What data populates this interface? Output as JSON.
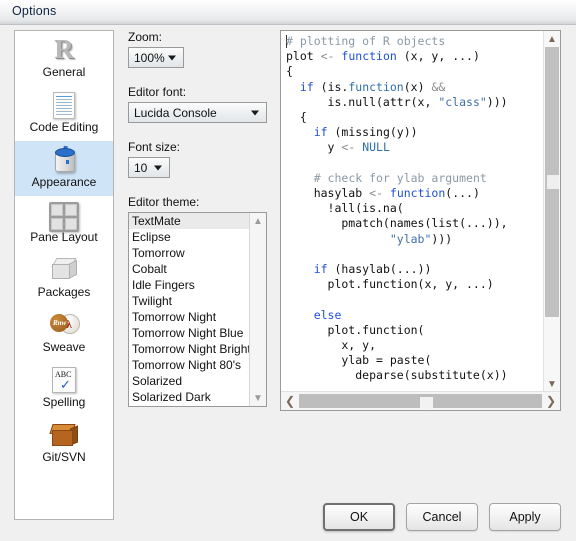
{
  "window": {
    "title": "Options"
  },
  "sidebar": {
    "items": [
      {
        "label": "General",
        "icon": "r-logo-icon",
        "selected": false
      },
      {
        "label": "Code Editing",
        "icon": "document-icon",
        "selected": false
      },
      {
        "label": "Appearance",
        "icon": "paint-can-icon",
        "selected": true
      },
      {
        "label": "Pane Layout",
        "icon": "panes-grid-icon",
        "selected": false
      },
      {
        "label": "Packages",
        "icon": "box-icon",
        "selected": false
      },
      {
        "label": "Sweave",
        "icon": "sweave-pdf-icon",
        "selected": false
      },
      {
        "label": "Spelling",
        "icon": "abc-check-icon",
        "selected": false
      },
      {
        "label": "Git/SVN",
        "icon": "crate-icon",
        "selected": false
      }
    ]
  },
  "settings": {
    "zoom": {
      "label": "Zoom:",
      "value": "100%"
    },
    "editor_font": {
      "label": "Editor font:",
      "value": "Lucida Console"
    },
    "font_size": {
      "label": "Font size:",
      "value": "10"
    },
    "editor_theme": {
      "label": "Editor theme:",
      "selected": "TextMate",
      "options": [
        "TextMate",
        "Eclipse",
        "Tomorrow",
        "Cobalt",
        "Idle Fingers",
        "Twilight",
        "Tomorrow Night",
        "Tomorrow Night Blue",
        "Tomorrow Night Bright",
        "Tomorrow Night 80's",
        "Solarized",
        "Solarized Dark"
      ]
    }
  },
  "preview": {
    "lines": [
      [
        {
          "t": "# plotting of R objects",
          "c": "cm"
        }
      ],
      [
        {
          "t": "plot ",
          "c": "pl"
        },
        {
          "t": "<-",
          "c": "op"
        },
        {
          "t": " ",
          "c": "pl"
        },
        {
          "t": "function",
          "c": "kw"
        },
        {
          "t": " (x, y, ...)",
          "c": "pl"
        }
      ],
      [
        {
          "t": "{",
          "c": "pl"
        }
      ],
      [
        {
          "t": "  ",
          "c": "pl"
        },
        {
          "t": "if",
          "c": "kw"
        },
        {
          "t": " (is.",
          "c": "pl"
        },
        {
          "t": "function",
          "c": "fn"
        },
        {
          "t": "(x) ",
          "c": "pl"
        },
        {
          "t": "&&",
          "c": "op"
        }
      ],
      [
        {
          "t": "      is.null(attr(x, ",
          "c": "pl"
        },
        {
          "t": "\"class\"",
          "c": "st"
        },
        {
          "t": ")))",
          "c": "pl"
        }
      ],
      [
        {
          "t": "  {",
          "c": "pl"
        }
      ],
      [
        {
          "t": "    ",
          "c": "pl"
        },
        {
          "t": "if",
          "c": "kw"
        },
        {
          "t": " (missing(y))",
          "c": "pl"
        }
      ],
      [
        {
          "t": "      y ",
          "c": "pl"
        },
        {
          "t": "<-",
          "c": "op"
        },
        {
          "t": " ",
          "c": "pl"
        },
        {
          "t": "NULL",
          "c": "fn"
        }
      ],
      [
        {
          "t": "",
          "c": "pl"
        }
      ],
      [
        {
          "t": "    ",
          "c": "pl"
        },
        {
          "t": "# check for ylab argument",
          "c": "cm"
        }
      ],
      [
        {
          "t": "    hasylab ",
          "c": "pl"
        },
        {
          "t": "<-",
          "c": "op"
        },
        {
          "t": " ",
          "c": "pl"
        },
        {
          "t": "function",
          "c": "kw"
        },
        {
          "t": "(...)",
          "c": "pl"
        }
      ],
      [
        {
          "t": "      !all(is.na(",
          "c": "pl"
        }
      ],
      [
        {
          "t": "        pmatch(names(list(...)),",
          "c": "pl"
        }
      ],
      [
        {
          "t": "               ",
          "c": "pl"
        },
        {
          "t": "\"ylab\"",
          "c": "st"
        },
        {
          "t": ")))",
          "c": "pl"
        }
      ],
      [
        {
          "t": "",
          "c": "pl"
        }
      ],
      [
        {
          "t": "    ",
          "c": "pl"
        },
        {
          "t": "if",
          "c": "kw"
        },
        {
          "t": " (hasylab(...))",
          "c": "pl"
        }
      ],
      [
        {
          "t": "      plot.function(x, y, ...)",
          "c": "pl"
        }
      ],
      [
        {
          "t": "",
          "c": "pl"
        }
      ],
      [
        {
          "t": "    ",
          "c": "pl"
        },
        {
          "t": "else",
          "c": "kw"
        }
      ],
      [
        {
          "t": "      plot.function(",
          "c": "pl"
        }
      ],
      [
        {
          "t": "        x, y,",
          "c": "pl"
        }
      ],
      [
        {
          "t": "        ylab = paste(",
          "c": "pl"
        }
      ],
      [
        {
          "t": "          deparse(substitute(x))",
          "c": "pl"
        }
      ]
    ]
  },
  "footer": {
    "ok": "OK",
    "cancel": "Cancel",
    "apply": "Apply"
  },
  "colors": {
    "selection": "#cfe4f7",
    "comment": "#8a9aa6",
    "keyword": "#1f4fd8",
    "string": "#3f6fa8",
    "dialog_bg": "#f0f0f0"
  }
}
